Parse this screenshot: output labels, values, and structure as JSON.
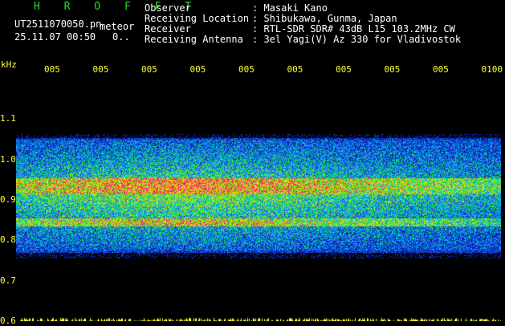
{
  "header": {
    "brand": "H R O F F T",
    "filename": "UT2511070050.pn",
    "meteor_label": "meteor",
    "datetime": "25.11.07 00:50",
    "count": "0..",
    "info_labels": [
      "Observer",
      "Receiving Location",
      "Receiver",
      "Receiving Antenna"
    ],
    "info_values": [
      ": Masaki Kano",
      ": Shibukawa, Gunma, Japan",
      ": RTL-SDR SDR# 43dB L15 103.2MHz CW",
      ": 3el Yagi(V) Az 330 for Vladivostok"
    ]
  },
  "chart_data": {
    "type": "heatmap",
    "ylabel": "kHz",
    "y_ticks": [
      "1.1",
      "1.0",
      "0.9",
      "0.8",
      "0.7",
      "0.6"
    ],
    "y_tick_values": [
      1.1,
      1.0,
      0.9,
      0.8,
      0.7,
      0.6
    ],
    "x_ticks": [
      "005",
      "005",
      "005",
      "005",
      "005",
      "005",
      "005",
      "005",
      "005",
      "0100"
    ],
    "ylim": [
      0.6,
      1.2
    ],
    "signal_band_khz": [
      0.775,
      1.05
    ],
    "strong_band_khz": [
      0.915,
      0.955
    ],
    "secondary_band_khz": [
      0.835,
      0.855
    ],
    "colors": {
      "background": "#000000",
      "noise_low": "#0a1aa0",
      "noise_mid": "#00c8c8",
      "noise_high": "#22dd22",
      "peak": "#ff2266",
      "text": "#ffff33",
      "header_white": "#ffffff",
      "brand_green": "#22dd22"
    }
  }
}
